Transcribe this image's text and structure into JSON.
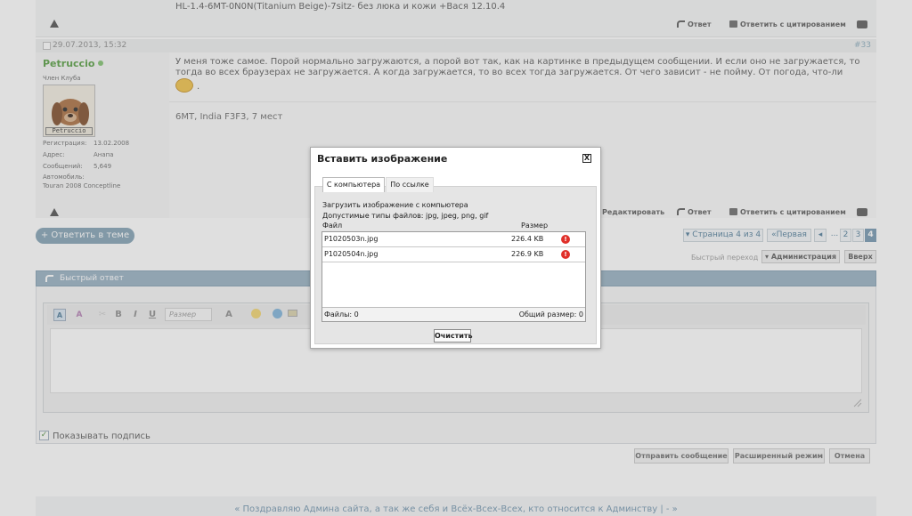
{
  "top_post": {
    "signature": "HL-1.4-6MT-0N0N(Titanium Beige)-7sitz- без люка и кожи +Вася 12.10.4",
    "reply_label": "Ответ",
    "quote_label": "Ответить с цитированием"
  },
  "post": {
    "date": "29.07.2013, 15:32",
    "number": "#33",
    "username": "Petruccio",
    "rank": "Член Клуба",
    "avatar_caption": "Petruccio",
    "info": [
      {
        "label": "Регистрация:",
        "value": "13.02.2008"
      },
      {
        "label": "Адрес:",
        "value": "Анапа"
      },
      {
        "label": "Сообщений:",
        "value": "5,649"
      },
      {
        "label": "Автомобиль:",
        "value": ""
      },
      {
        "label": "Touran 2008 Conceptline",
        "value": ""
      }
    ],
    "message": "У меня тоже самое. Порой нормально загружаются, а порой вот так, как на картинке в предыдущем сообщении. И если оно не загружается, то тогда во всех браузерах не загружается. А когда загружается, то во всех тогда загружается. От чего зависит - не пойму. От погода, что-ли",
    "message_tail": ".",
    "signature": "6MT, India F3F3, 7 мест",
    "edit_label": "Редактировать",
    "reply_label": "Ответ",
    "quote_label": "Ответить с цитированием"
  },
  "pagination": {
    "reply_button": "+ Ответить в теме",
    "page_info": "▾ Страница 4 из 4",
    "first": "«Первая",
    "prev": "◂",
    "ellipsis": "...",
    "pages": [
      "2",
      "3",
      "4"
    ],
    "current": "4",
    "quick_nav_label": "Быстрый переход",
    "admin_select": "▾ Администрация",
    "up_button": "Вверх"
  },
  "quick_reply": {
    "title": "Быстрый ответ",
    "toolbar": {
      "bold": "B",
      "italic": "I",
      "underline": "U",
      "size_placeholder": "Размер",
      "font_color": "A"
    },
    "show_signature": "Показывать подпись",
    "submit": "Отправить сообщение",
    "advanced": "Расширенный режим",
    "cancel": "Отмена"
  },
  "footer": {
    "text": "« Поздравляю Админа сайта, а так же себя и Всёх-Всех-Всех, кто относится к Админству | - »"
  },
  "dialog": {
    "title": "Вставить изображение",
    "close": "X",
    "tabs": [
      "С компьютера",
      "По ссылке"
    ],
    "upload_caption": "Загрузить изображение с компьютера",
    "allowed_types": "Допустимые типы файлов: jpg, jpeg, png, gif",
    "col_file": "Файл",
    "col_size": "Размер",
    "files": [
      {
        "name": "P1020503n.jpg",
        "size": "226.4 KB",
        "status": "!"
      },
      {
        "name": "P1020504n.jpg",
        "size": "226.9 KB",
        "status": "!"
      }
    ],
    "files_count": "Файлы: 0",
    "total_size": "Общий размер: 0",
    "clear_button": "Очистить"
  },
  "colors": {
    "username": "#4f9a3a",
    "link_blue": "#6f93ad",
    "header_blue": "#93adc0",
    "error_red": "#e0302a"
  }
}
